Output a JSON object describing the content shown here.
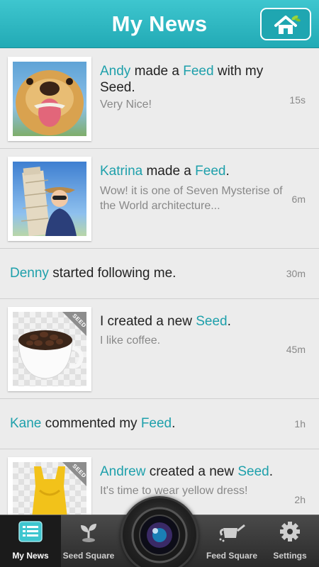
{
  "header": {
    "title": "My News"
  },
  "feed": [
    {
      "actor": "Andy",
      "mid": " made a ",
      "obj": "Feed",
      "tail": " with my Seed.",
      "sub": "Very Nice!",
      "time": "15s"
    },
    {
      "actor": "Katrina",
      "mid": " made a ",
      "obj": "Feed",
      "tail": ".",
      "sub": "Wow! it is one of Seven Mysterise of the World architecture...",
      "time": "6m"
    },
    {
      "actor": "Denny",
      "text": " started following me.",
      "time": "30m"
    },
    {
      "pre": "I created a new ",
      "obj": "Seed",
      "tail": ".",
      "sub": "I like coffee.",
      "time": "45m",
      "badge": "SEED"
    },
    {
      "actor": "Kane",
      "mid": " commented my ",
      "obj": "Feed",
      "tail": ".",
      "time": "1h"
    },
    {
      "actor": "Andrew",
      "mid": " created a new ",
      "obj": "Seed",
      "tail": ".",
      "sub": "It's time to wear yellow dress!",
      "time": "2h",
      "badge": "SEED"
    }
  ],
  "tabbar": {
    "tabs": [
      {
        "label": "My News",
        "icon": "news-list-icon",
        "active": true
      },
      {
        "label": "Seed Square",
        "icon": "sprout-icon"
      },
      {
        "label": "Feed Square",
        "icon": "watering-can-icon"
      },
      {
        "label": "Settings",
        "icon": "gear-icon"
      }
    ],
    "camera": "camera-lens-icon"
  },
  "colors": {
    "accent": "#22aab5",
    "link": "#1ea0ab",
    "text": "#222222",
    "muted": "#888888",
    "tabbar": "#333333"
  }
}
